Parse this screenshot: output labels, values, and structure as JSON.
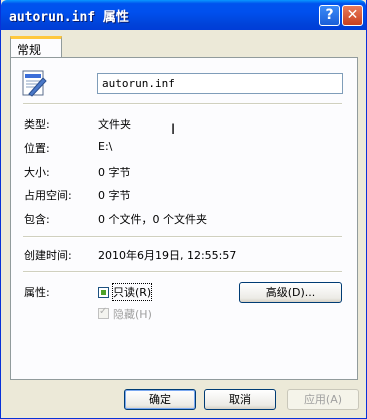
{
  "window": {
    "title": "autorun.inf 属性"
  },
  "titlebar": {
    "help_glyph": "?",
    "close_glyph": "✕"
  },
  "tabs": [
    {
      "label": "常规",
      "selected": true
    }
  ],
  "file": {
    "name": "autorun.inf",
    "icon": "file-properties-icon"
  },
  "properties": [
    {
      "label": "类型:",
      "value": "文件夹"
    },
    {
      "label": "位置:",
      "value": "E:\\"
    },
    {
      "label": "大小:",
      "value": "0 字节"
    },
    {
      "label": "占用空间:",
      "value": "0 字节"
    },
    {
      "label": "包含:",
      "value": "0 个文件，0 个文件夹"
    },
    {
      "label": "创建时间:",
      "value": "2010年6月19日, 12:55:57"
    }
  ],
  "attributes": {
    "label": "属性:",
    "readonly": {
      "label": "只读(R)",
      "checked": true
    },
    "hidden": {
      "label": "隐藏(H)",
      "checked": true,
      "disabled": true
    },
    "advanced_button": "高级(D)..."
  },
  "buttons": {
    "ok": "确定",
    "cancel": "取消",
    "apply": "应用(A)"
  },
  "colors": {
    "title_bar": "#0053ee",
    "dialog_bg": "#ece9d8",
    "tab_highlight": "#ffc83c",
    "check_fill": "#4ea22a"
  }
}
